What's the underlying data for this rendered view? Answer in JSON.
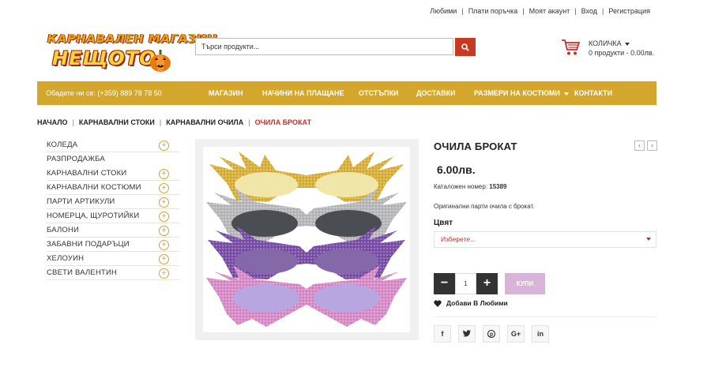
{
  "top_links": [
    "Любими",
    "Плати поръчка",
    "Моят акаунт",
    "Вход",
    "Регистрация"
  ],
  "logo": {
    "line1": "КАРНАВАЛЕН МАГАЗИН",
    "line2": "НЕЩОТО"
  },
  "search": {
    "placeholder": "Търси продукти..."
  },
  "cart": {
    "label": "КОЛИЧКА",
    "summary": "0 продукти - 0.00лв."
  },
  "nav": {
    "phone": "Обадете ни се: (+359) 889 78 78 50",
    "items": [
      "МАГАЗИН",
      "НАЧИНИ НА ПЛАЩАНЕ",
      "ОТСТЪПКИ",
      "ДОСТАВКИ",
      "РАЗМЕРИ НА КОСТЮМИ",
      "КОНТАКТИ"
    ]
  },
  "breadcrumb": [
    "НАЧАЛО",
    "КАРНАВАЛНИ СТОКИ",
    "КАРНАВАЛНИ ОЧИЛА",
    "ОЧИЛА БРОКАТ"
  ],
  "sidebar": {
    "categories": [
      "КОЛЕДА",
      "РАЗПРОДАЖБА",
      "КАРНАВАЛНИ СТОКИ",
      "КАРНАВАЛНИ КОСТЮМИ",
      "ПАРТИ АРТИКУЛИ",
      "НОМЕРЦА, ЩУРОТИЙКИ",
      "БАЛОНИ",
      "ЗАБАВНИ ПОДАРЪЦИ",
      "ХЕЛОУИН",
      "СВЕТИ ВАЛЕНТИН"
    ]
  },
  "product": {
    "title": "ОЧИЛА БРОКАТ",
    "price": "6.00лв.",
    "catalog_label": "Каталожен номер:",
    "catalog_number": "15389",
    "description": "Оригинални парти очила с брокат.",
    "color_label": "Цвят",
    "color_select": "Изберете...",
    "quantity": "1",
    "buy_label": "КУПИ",
    "wishlist_label": "Добави В Любими"
  },
  "share": [
    "f",
    "t",
    "p",
    "G+",
    "in"
  ],
  "colors": {
    "accent": "#d4a72c",
    "red": "#c4302b",
    "search_button": "#c63a22",
    "buy_button": "#d8b4d8"
  }
}
